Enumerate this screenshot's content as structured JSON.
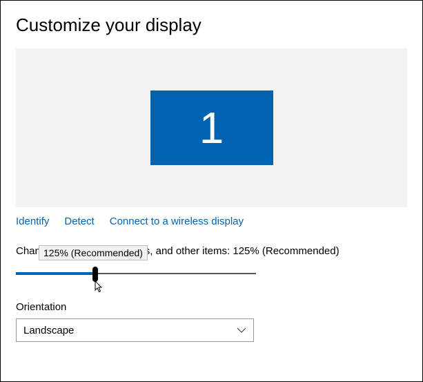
{
  "title": "Customize your display",
  "preview": {
    "monitor_label": "1"
  },
  "links": {
    "identify": "Identify",
    "detect": "Detect",
    "connect_wireless": "Connect to a wireless display"
  },
  "tooltip": "125% (Recommended)",
  "scale": {
    "label_prefix": "Change the size of text, apps, and other items: ",
    "value_text": "125% (Recommended)"
  },
  "orientation": {
    "label": "Orientation",
    "selected": "Landscape"
  }
}
